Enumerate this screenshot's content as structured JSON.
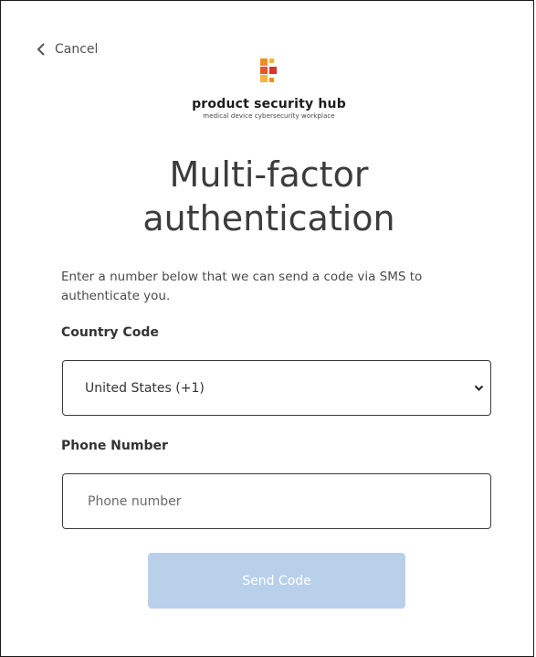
{
  "nav": {
    "cancel_label": "Cancel"
  },
  "brand": {
    "name": "product security hub",
    "tagline": "medical device cybersecurity workplace",
    "colors": {
      "orange": "#f28c28",
      "red": "#e0322b",
      "yellow": "#f7b731"
    }
  },
  "page": {
    "title_line1": "Multi-factor",
    "title_line2": "authentication",
    "description": "Enter a number below that we can send a code via SMS to authenticate you."
  },
  "form": {
    "country_label": "Country Code",
    "country_value": "United States (+1)",
    "phone_label": "Phone Number",
    "phone_placeholder": "Phone number",
    "phone_value": "",
    "submit_label": "Send Code",
    "submit_color": "#b9d0eb"
  }
}
